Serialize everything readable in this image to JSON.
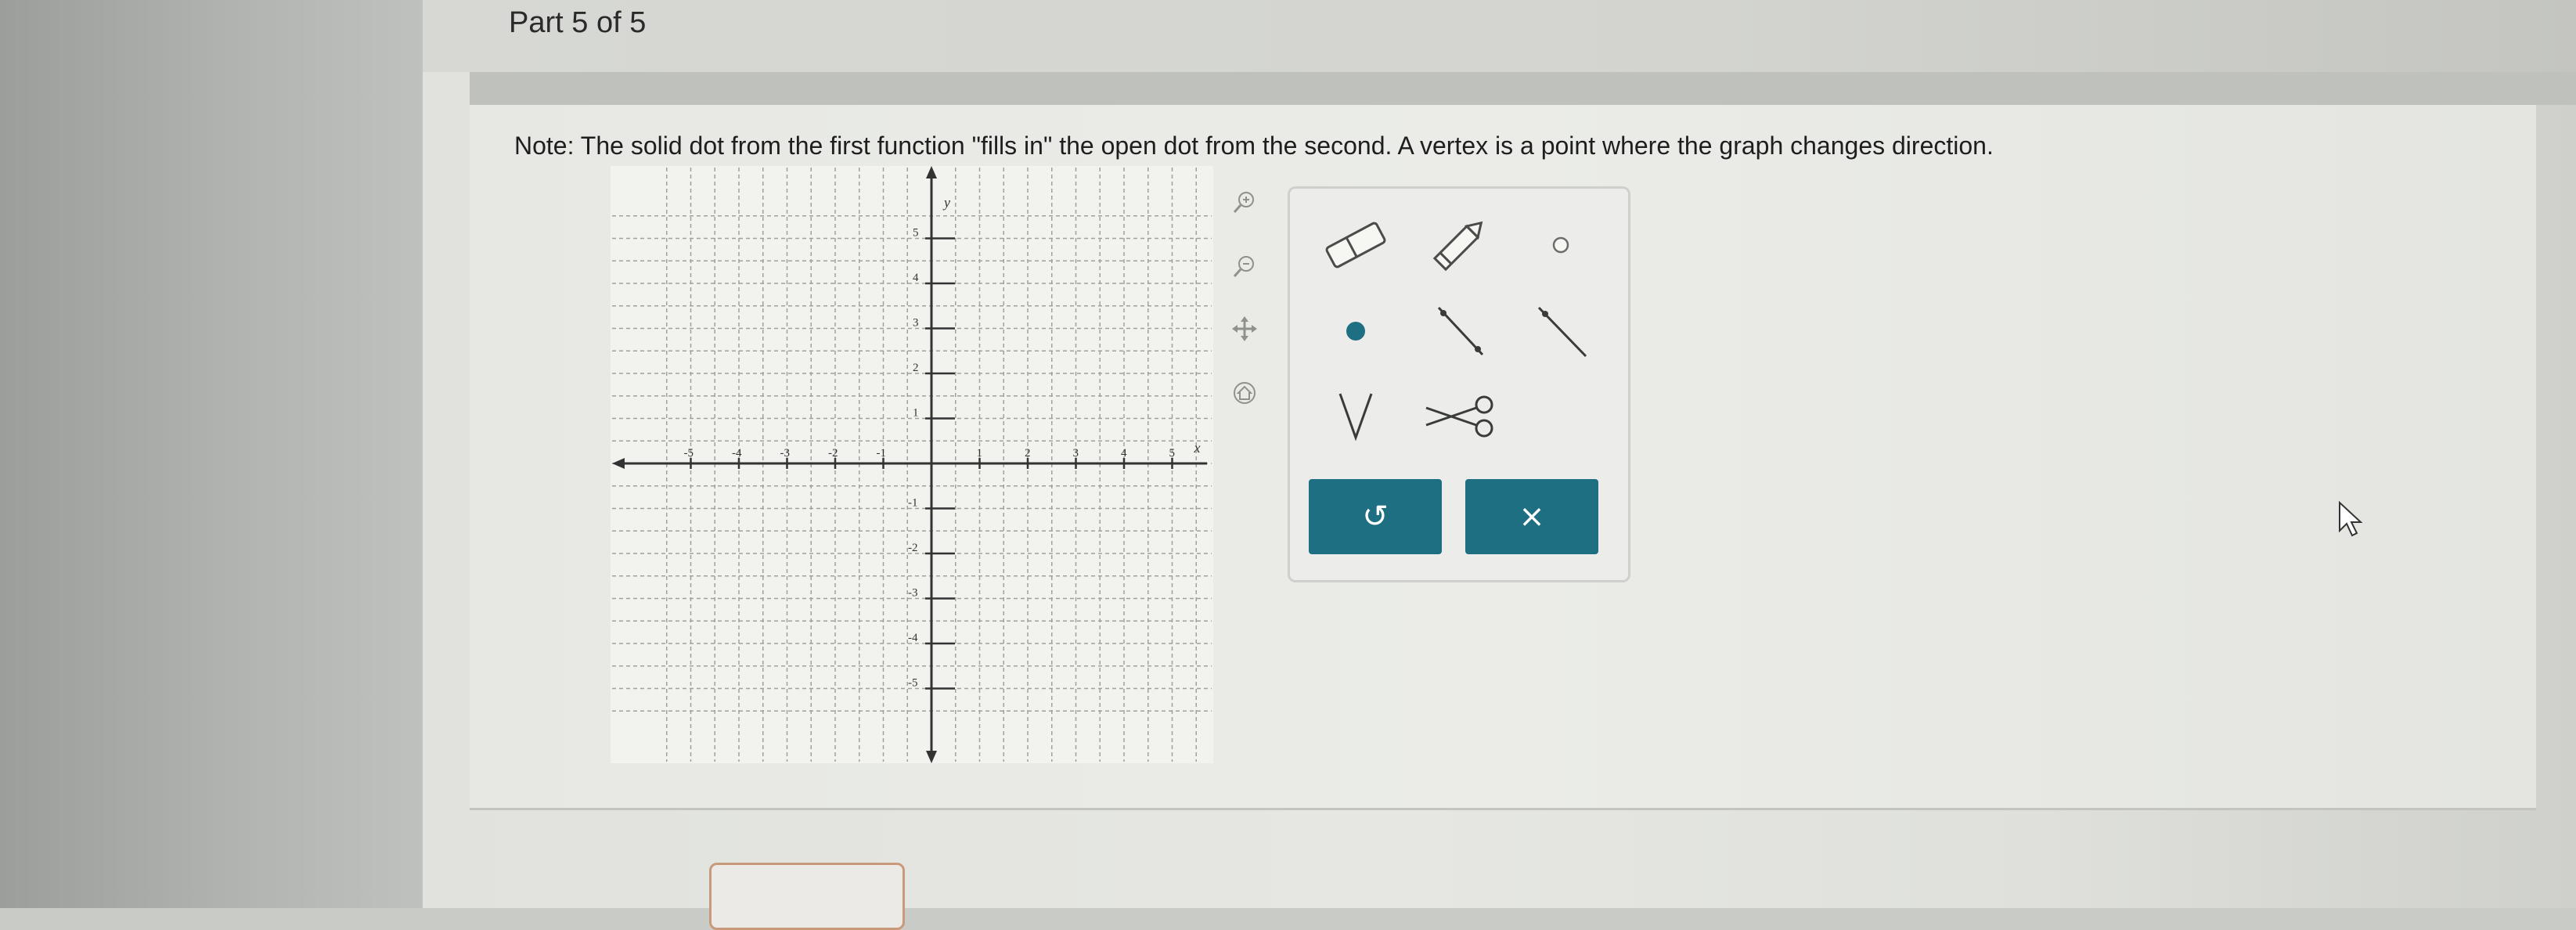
{
  "header": {
    "part_label": "Part 5 of 5"
  },
  "note": {
    "text": "Note: The solid dot from the first function \"fills in\" the open dot from the second. A vertex is a point where the graph changes direction."
  },
  "graph": {
    "x_axis_label": "x",
    "y_axis_label": "y",
    "x_range": [
      -5,
      5
    ],
    "y_range": [
      -5,
      5
    ],
    "x_ticks": [
      -5,
      -4,
      -3,
      -2,
      -1,
      1,
      2,
      3,
      4,
      5
    ],
    "y_ticks": [
      5,
      4,
      3,
      2,
      1,
      -1,
      -2,
      -3,
      -4,
      -5
    ]
  },
  "side_icons": [
    "zoom-in-icon",
    "zoom-out-icon",
    "pan-icon",
    "home-icon"
  ],
  "tools": {
    "row1": [
      "eraser-icon",
      "pencil-icon",
      "open-dot-icon"
    ],
    "row2": [
      "solid-dot-icon",
      "segment-icon",
      "ray-icon"
    ],
    "row3": [
      "vertex-icon",
      "scissors-icon"
    ]
  },
  "actions": {
    "undo_label": "↺",
    "clear_label": "×"
  },
  "colors": {
    "accent": "#1f6f82",
    "dot": "#1f6f82"
  }
}
